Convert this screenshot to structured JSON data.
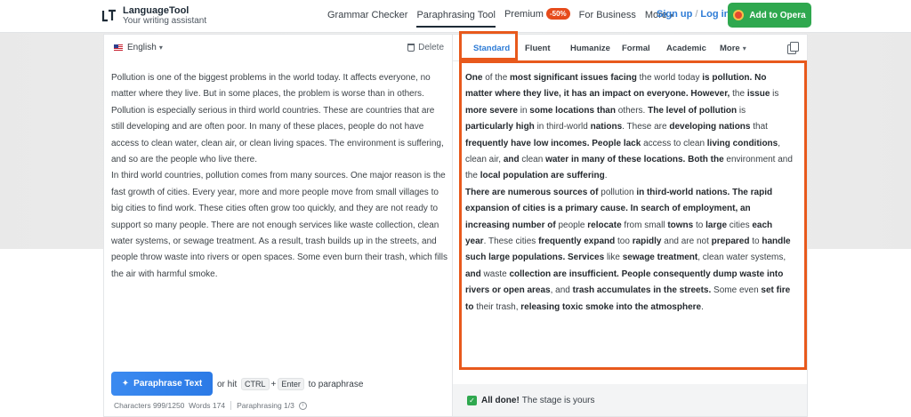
{
  "header": {
    "brand_name": "LanguageTool",
    "brand_tagline": "Your writing assistant",
    "nav": [
      {
        "label": "Grammar Checker",
        "active": false
      },
      {
        "label": "Paraphrasing Tool",
        "active": true
      },
      {
        "label": "Premium",
        "active": false,
        "badge": "-50%"
      },
      {
        "label": "For Business",
        "active": false
      },
      {
        "label": "More",
        "active": false
      }
    ],
    "signup_label": "Sign up",
    "separator": "/",
    "login_label": "Log in",
    "cta_label": "Add to Opera",
    "cta_color": "#2fa84f",
    "badge_color": "#e64b1b"
  },
  "left": {
    "language": "English",
    "delete_label": "Delete",
    "paragraphs": [
      "Pollution is one of the biggest problems in the world today. It affects everyone, no matter where they live. But in some places, the problem is worse than in others. Pollution is especially serious in third world countries. These are countries that are still developing and are often poor. In many of these places, people do not have access to clean water, clean air, or clean living spaces. The environment is suffering, and so are the people who live there.",
      "In third world countries, pollution comes from many sources. One major reason is the fast growth of cities. Every year, more and more people move from small villages to big cities to find work. These cities often grow too quickly, and they are not ready to support so many people. There are not enough services like waste collection, clean water systems, or sewage treatment. As a result, trash builds up in the streets, and people throw waste into rivers or open spaces. Some even burn their trash, which fills the air with harmful smoke."
    ],
    "paraphrase_button": "Paraphrase Text",
    "hint_prefix": "or hit",
    "key_ctrl": "CTRL",
    "key_plus": "+",
    "key_enter": "Enter",
    "hint_suffix": "to paraphrase",
    "characters_label": "Characters",
    "characters_value": "999/1250",
    "words_label": "Words",
    "words_value": "174",
    "paraphrasing_label": "Paraphrasing 1/3",
    "accent_color": "#2e7cd6"
  },
  "right": {
    "tabs": [
      "Standard",
      "Fluent",
      "Humanize",
      "Formal",
      "Academic",
      "More"
    ],
    "active_tab": "Standard",
    "output_paragraphs": [
      [
        {
          "t": "One",
          "b": true
        },
        {
          "t": " of the ",
          "b": false
        },
        {
          "t": "most significant issues facing",
          "b": true
        },
        {
          "t": " the world today ",
          "b": false
        },
        {
          "t": "is pollution. No matter where they live, it has an impact on everyone. However,",
          "b": true
        },
        {
          "t": " the ",
          "b": false
        },
        {
          "t": "issue",
          "b": true
        },
        {
          "t": " is ",
          "b": false
        },
        {
          "t": "more severe",
          "b": true
        },
        {
          "t": " in ",
          "b": false
        },
        {
          "t": "some locations than",
          "b": true
        },
        {
          "t": " others. ",
          "b": false
        },
        {
          "t": "The level of pollution",
          "b": true
        },
        {
          "t": " is ",
          "b": false
        },
        {
          "t": "particularly high",
          "b": true
        },
        {
          "t": " in third-world ",
          "b": false
        },
        {
          "t": "nations",
          "b": true
        },
        {
          "t": ". These are ",
          "b": false
        },
        {
          "t": "developing nations",
          "b": true
        },
        {
          "t": " that ",
          "b": false
        },
        {
          "t": "frequently have low incomes. People lack",
          "b": true
        },
        {
          "t": " access to clean ",
          "b": false
        },
        {
          "t": "living conditions",
          "b": true
        },
        {
          "t": ", clean air, ",
          "b": false
        },
        {
          "t": "and",
          "b": true
        },
        {
          "t": " clean ",
          "b": false
        },
        {
          "t": "water in many of these locations. Both the",
          "b": true
        },
        {
          "t": " environment and the ",
          "b": false
        },
        {
          "t": "local population are suffering",
          "b": true
        },
        {
          "t": ".",
          "b": false
        }
      ],
      [
        {
          "t": "There are numerous sources of",
          "b": true
        },
        {
          "t": " pollution ",
          "b": false
        },
        {
          "t": "in third-world nations. The rapid expansion of cities is a primary cause. In search of employment, an increasing number of",
          "b": true
        },
        {
          "t": " people ",
          "b": false
        },
        {
          "t": "relocate",
          "b": true
        },
        {
          "t": " from small ",
          "b": false
        },
        {
          "t": "towns",
          "b": true
        },
        {
          "t": " to ",
          "b": false
        },
        {
          "t": "large",
          "b": true
        },
        {
          "t": " cities ",
          "b": false
        },
        {
          "t": "each year",
          "b": true
        },
        {
          "t": ". These cities ",
          "b": false
        },
        {
          "t": "frequently expand",
          "b": true
        },
        {
          "t": " too ",
          "b": false
        },
        {
          "t": "rapidly",
          "b": true
        },
        {
          "t": " and are not ",
          "b": false
        },
        {
          "t": "prepared",
          "b": true
        },
        {
          "t": " to ",
          "b": false
        },
        {
          "t": "handle such large populations. Services",
          "b": true
        },
        {
          "t": " like ",
          "b": false
        },
        {
          "t": "sewage treatment",
          "b": true
        },
        {
          "t": ", clean water systems, ",
          "b": false
        },
        {
          "t": "and",
          "b": true
        },
        {
          "t": " waste ",
          "b": false
        },
        {
          "t": "collection are insufficient. People consequently dump waste into rivers or open areas",
          "b": true
        },
        {
          "t": ", and ",
          "b": false
        },
        {
          "t": "trash accumulates in the streets.",
          "b": true
        },
        {
          "t": " Some even ",
          "b": false
        },
        {
          "t": "set fire to",
          "b": true
        },
        {
          "t": " their trash, ",
          "b": false
        },
        {
          "t": "releasing toxic smoke into the atmosphere",
          "b": true
        },
        {
          "t": ".",
          "b": false
        }
      ]
    ],
    "status_bold": "All done!",
    "status_text": "The stage is yours",
    "highlight_color": "#e8591c"
  }
}
